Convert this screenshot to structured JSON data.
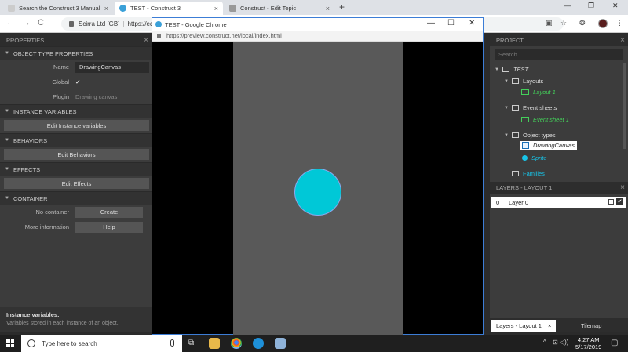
{
  "browser": {
    "tabs": [
      {
        "label": "Search the Construct 3 Manual",
        "close": "×"
      },
      {
        "label": "TEST - Construct 3",
        "close": "×"
      },
      {
        "label": "Construct - Edit Topic",
        "close": "×"
      }
    ],
    "new_tab": "+",
    "window_controls": {
      "minimize": "—",
      "maximize": "❐",
      "close": "✕"
    },
    "nav": {
      "back": "←",
      "forward": "→",
      "reload": "C"
    },
    "address_prefix": "Scirra Ltd [GB]",
    "address_url": "https://editor"
  },
  "properties_panel": {
    "header": "PROPERTIES",
    "close": "×",
    "sections": {
      "object_type": {
        "title": "OBJECT TYPE PROPERTIES",
        "name_label": "Name",
        "name_value": "DrawingCanvas",
        "global_label": "Global",
        "global_value": "✔",
        "plugin_label": "Plugin",
        "plugin_value": "Drawing canvas"
      },
      "instance_variables": {
        "title": "INSTANCE VARIABLES",
        "button": "Edit Instance variables"
      },
      "behaviors": {
        "title": "BEHAVIORS",
        "button": "Edit Behaviors"
      },
      "effects": {
        "title": "EFFECTS",
        "button": "Edit Effects"
      },
      "container": {
        "title": "CONTAINER",
        "no_container_label": "No container",
        "create_button": "Create",
        "more_info_label": "More information",
        "help_button": "Help"
      }
    },
    "footer": {
      "title": "Instance variables:",
      "description": "Variables stored in each instance of an object."
    }
  },
  "preview_window": {
    "title": "TEST - Google Chrome",
    "url": "https://preview.construct.net/local/index.html",
    "controls": {
      "minimize": "—",
      "maximize": "☐",
      "close": "✕"
    },
    "sprite_color": "#00c8d7",
    "canvas_color": "#595959"
  },
  "project_panel": {
    "header": "PROJECT",
    "close": "×",
    "search_placeholder": "Search",
    "tree": {
      "root": "TEST",
      "layouts": "Layouts",
      "layout_1": "Layout 1",
      "event_sheets": "Event sheets",
      "event_sheet_1": "Event sheet 1",
      "object_types": "Object types",
      "drawing_canvas": "DrawingCanvas",
      "sprite": "Sprite",
      "families": "Families"
    }
  },
  "layers_panel": {
    "header": "LAYERS - LAYOUT 1",
    "close": "×",
    "layers": [
      {
        "index": "0",
        "name": "Layer 0",
        "visible_check": "✔"
      }
    ]
  },
  "bottom_tabs": {
    "layers": "Layers - Layout 1",
    "layers_close": "×",
    "tilemap": "Tilemap"
  },
  "taskbar": {
    "search_placeholder": "Type here to search",
    "time": "4:27 AM",
    "date": "5/17/2019",
    "tray_chevron": "^",
    "tray_icons": "⊡ ◁))",
    "notifications": "▢",
    "task_view": "⧉"
  }
}
